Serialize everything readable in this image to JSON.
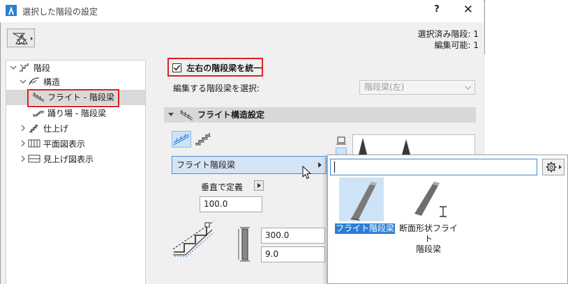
{
  "window": {
    "title": "選択した階段の設定",
    "help": "?",
    "close": "✕"
  },
  "info": {
    "selected": "選択済み階段: 1",
    "editable": "編集可能: 1"
  },
  "tree": {
    "items": [
      {
        "label": "階段"
      },
      {
        "label": "構造"
      },
      {
        "label": "フライト - 階段梁"
      },
      {
        "label": "踊り場 - 階段梁"
      },
      {
        "label": "仕上げ"
      },
      {
        "label": "平面図表示"
      },
      {
        "label": "見上げ図表示"
      }
    ]
  },
  "panel": {
    "unify_label": "左右の階段梁を統一",
    "unify_checked": true,
    "edit_beam_label": "編集する階段梁を選択:",
    "edit_beam_value": "階段梁(左)",
    "section_title": "フライト構造設定",
    "type_value": "フライト階段梁",
    "vertical_label": "垂直で定義",
    "input_1": "100.0",
    "input_2": "300.0",
    "input_3": "9.0"
  },
  "popup": {
    "search_value": "",
    "tiles": [
      {
        "label": "フライト階段梁",
        "selected": true
      },
      {
        "label_lines": [
          "断面形状フライト",
          "階段梁"
        ],
        "selected": false
      }
    ]
  },
  "colors": {
    "red_highlight": "#e02020",
    "selection_blue": "#3a87d6",
    "selected_tile_bg": "#cfe3f6"
  }
}
